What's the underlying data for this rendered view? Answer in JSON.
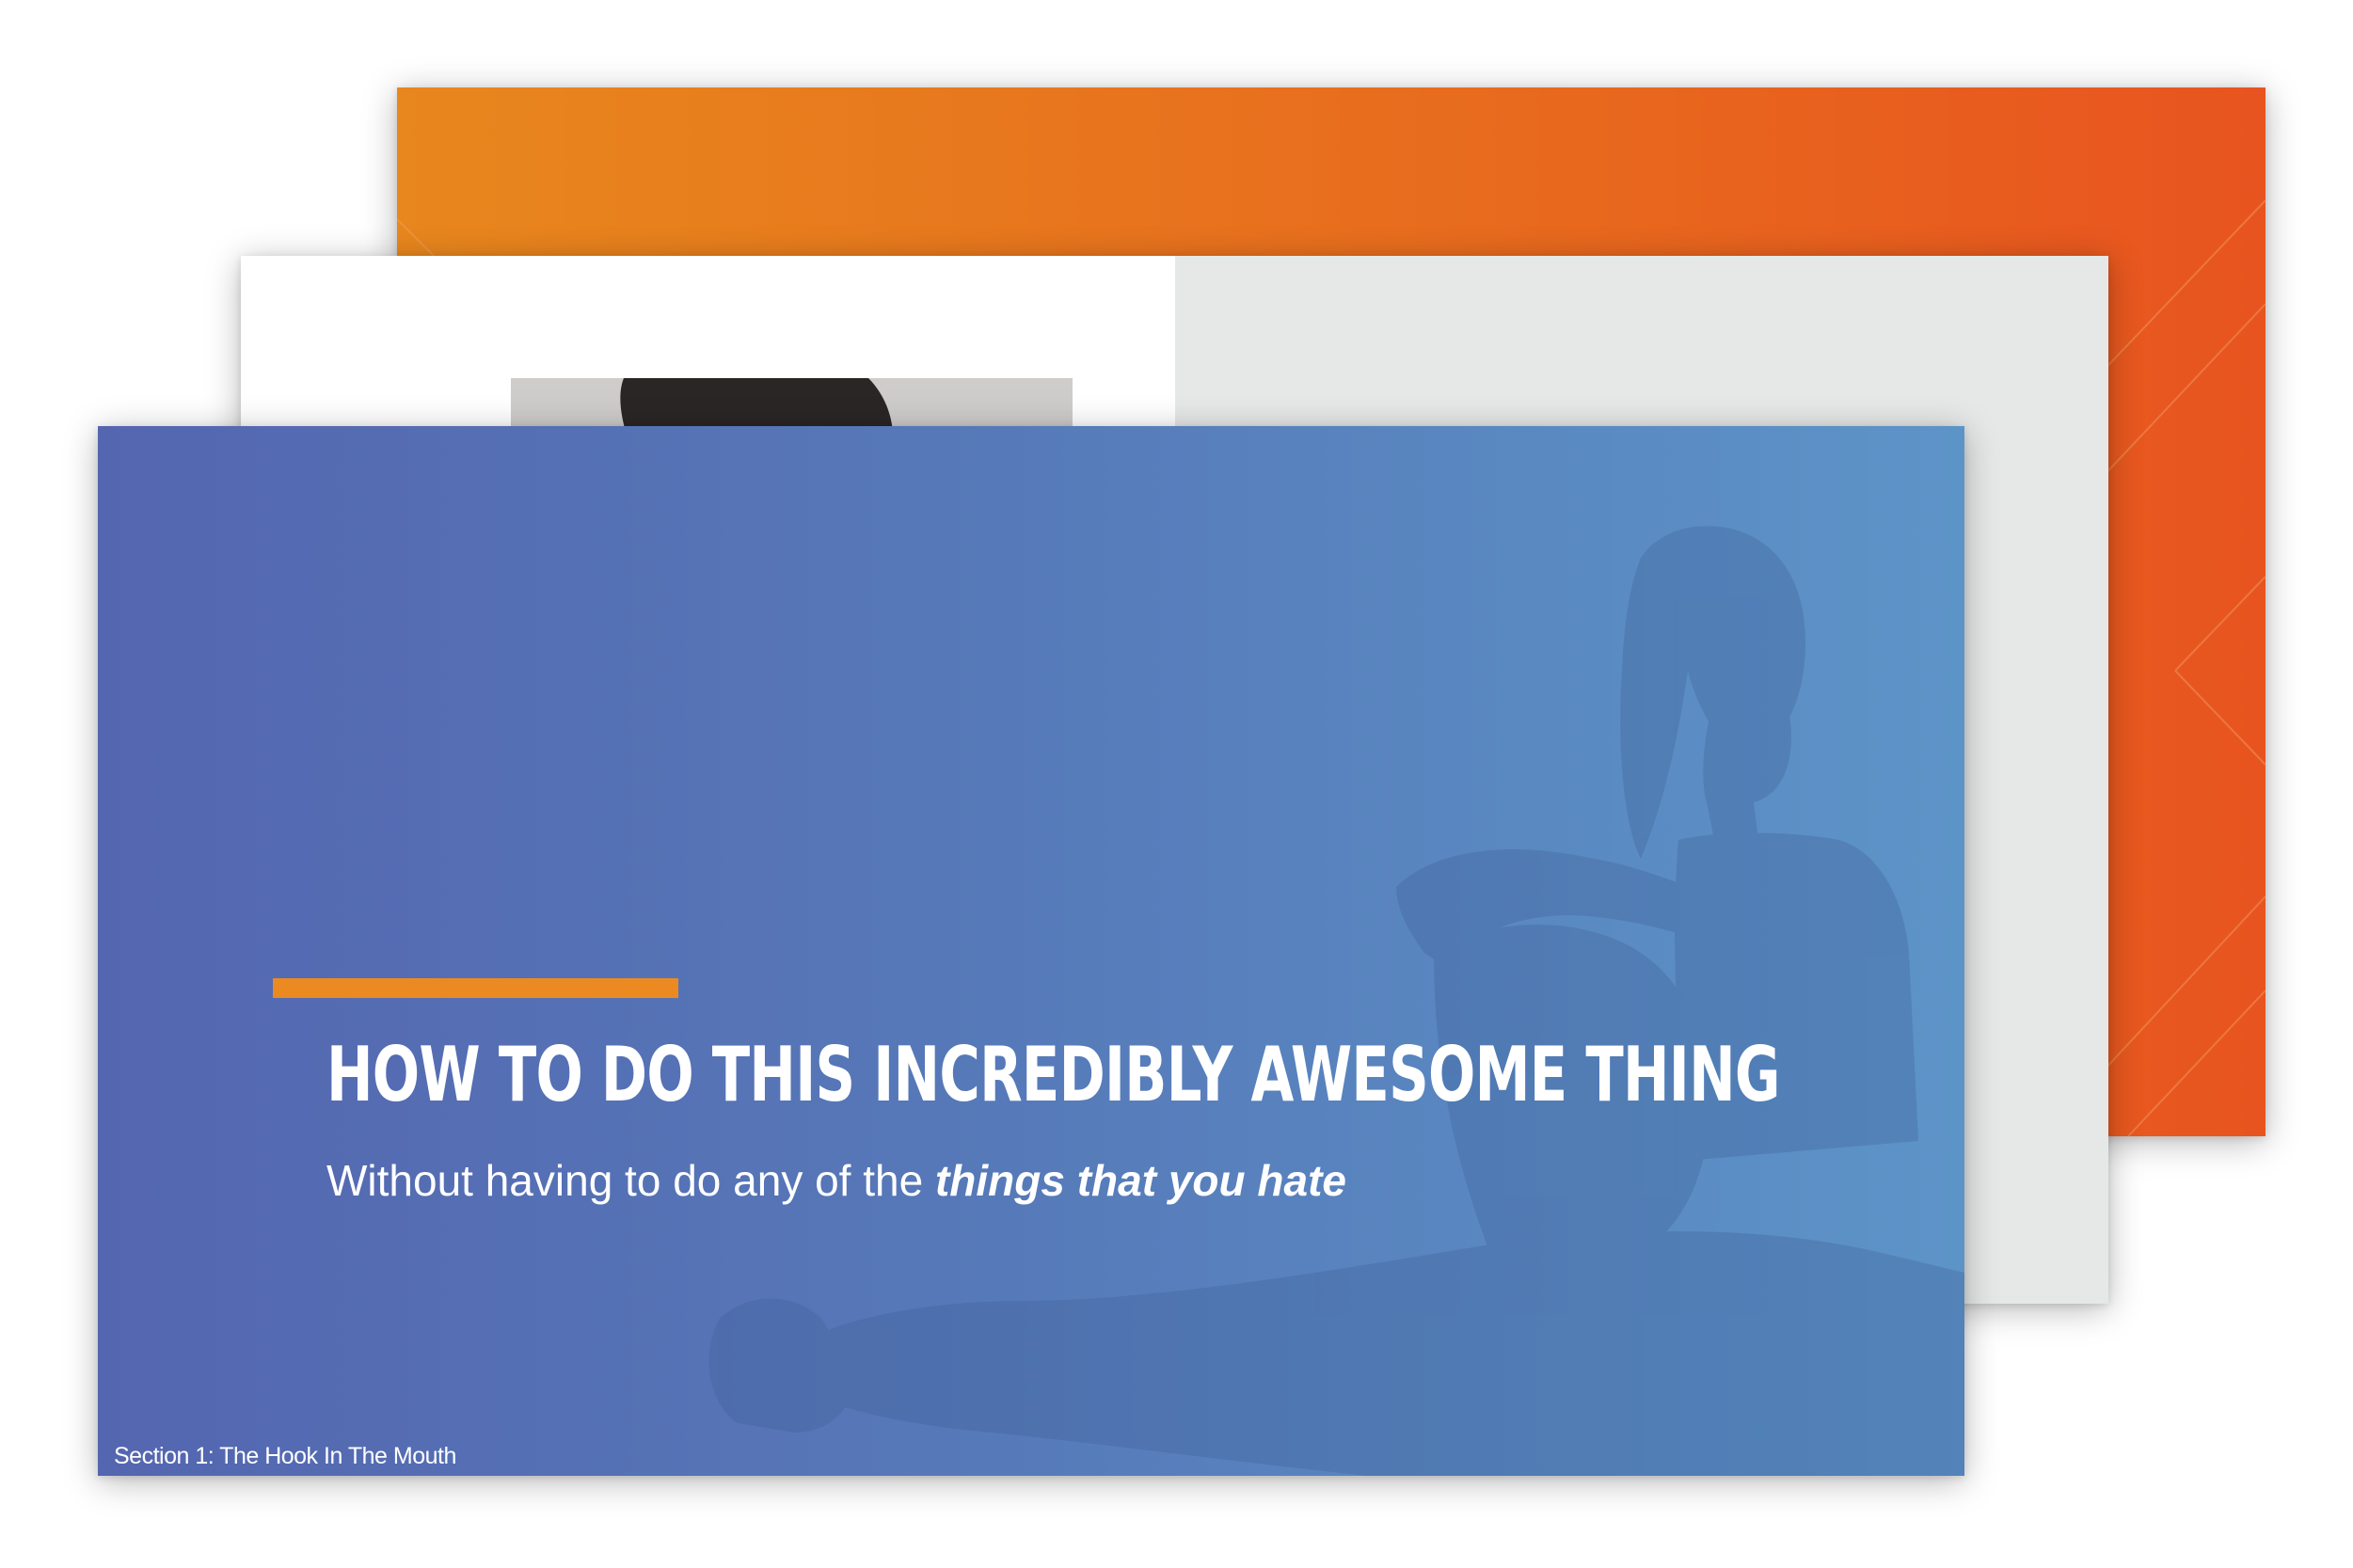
{
  "slides": {
    "front": {
      "title": "HOW TO DO THIS INCREDIBLY AWESOME THING",
      "subtitle_plain": "Without having to do any of the ",
      "subtitle_emphasis": "things that you hate",
      "footer": "Section 1: The Hook In The Mouth"
    }
  },
  "colors": {
    "accent": "#ec8a22",
    "front_background": "#5678b8",
    "back_background": "#e86a1e",
    "mid_panel": "#e5e8e7",
    "text": "#ffffff"
  }
}
